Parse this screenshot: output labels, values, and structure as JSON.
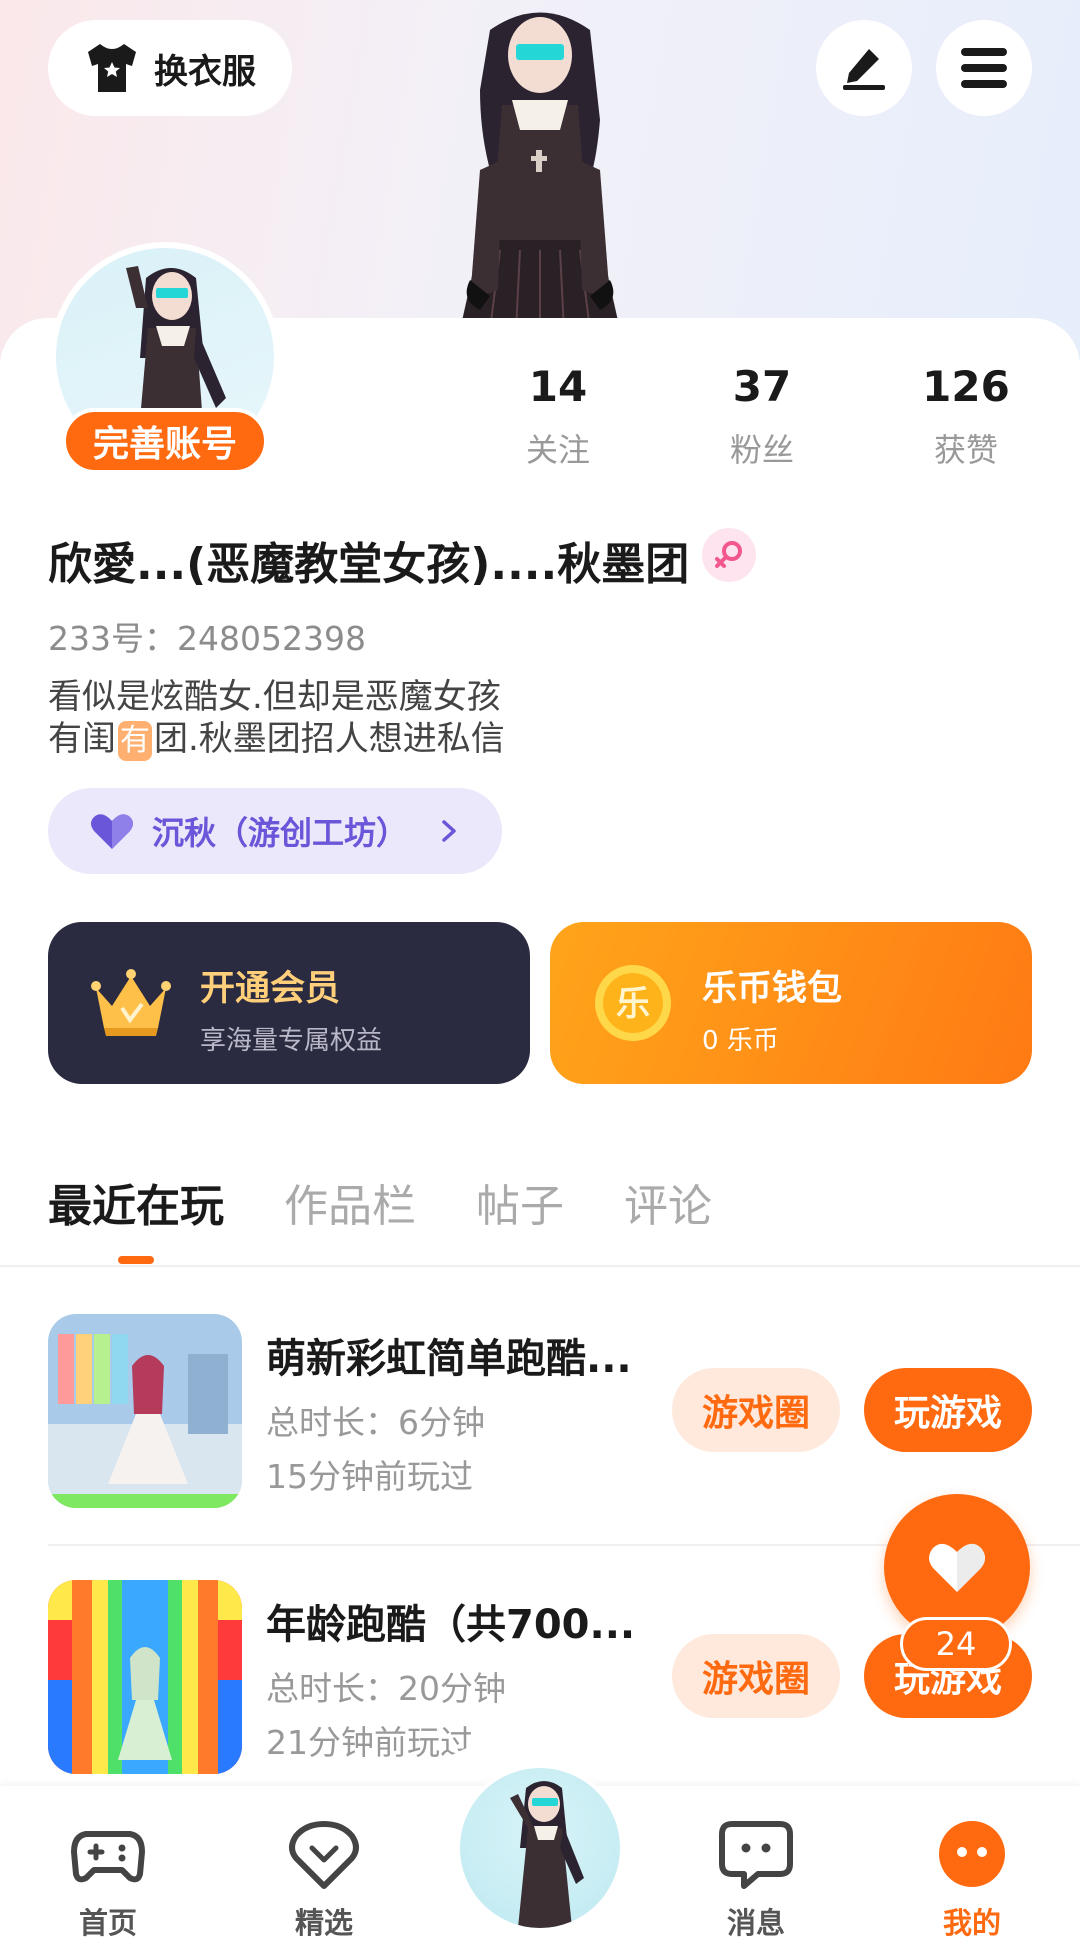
{
  "header": {
    "outfit_label": "换衣服",
    "icons": {
      "outfit": "shirt-icon",
      "edit": "pen-icon",
      "menu": "hamburger-menu-icon"
    }
  },
  "profile": {
    "complete_label": "完善账号",
    "stats": [
      {
        "value": "14",
        "label": "关注"
      },
      {
        "value": "37",
        "label": "粉丝"
      },
      {
        "value": "126",
        "label": "获赞"
      }
    ],
    "nickname": "欣愛...(恶魔教堂女孩)....秋墨团",
    "gender": "female",
    "uid": "233号：248052398",
    "bio_line1": "看似是炫酷女.但却是恶魔女孩",
    "bio_line2_a": "有闺",
    "bio_line2_badge": "有",
    "bio_line2_b": "团.秋墨团招人想进私信",
    "studio": "沉秋（游创工坊）"
  },
  "cards": {
    "vip": {
      "title": "开通会员",
      "subtitle": "享海量专属权益",
      "icon": "crown-icon"
    },
    "wallet": {
      "title": "乐币钱包",
      "subtitle": "0 乐币",
      "icon": "coin-icon",
      "coin_char": "乐"
    }
  },
  "tabs": [
    "最近在玩",
    "作品栏",
    "帖子",
    "评论"
  ],
  "active_tab": "最近在玩",
  "games": [
    {
      "title": "萌新彩虹简单跑酷...",
      "duration": "总时长：6分钟",
      "last_played": "15分钟前玩过",
      "circle_label": "游戏圈",
      "play_label": "玩游戏"
    },
    {
      "title": "年龄跑酷（共700...",
      "duration": "总时长：20分钟",
      "last_played": "21分钟前玩过",
      "circle_label": "游戏圈",
      "play_label": "玩游戏"
    }
  ],
  "fab": {
    "icon": "heart-icon",
    "count": "24"
  },
  "bottom_nav": [
    {
      "label": "首页",
      "icon": "gamepad-icon"
    },
    {
      "label": "精选",
      "icon": "heart-chat-icon"
    },
    {
      "label": "消息",
      "icon": "message-icon"
    },
    {
      "label": "我的",
      "icon": "face-icon"
    }
  ],
  "colors": {
    "accent": "#ff6a10",
    "vip_bg": "#2a2a40",
    "wallet_bg": "#ffa51a",
    "studio_text": "#6a56d8"
  }
}
